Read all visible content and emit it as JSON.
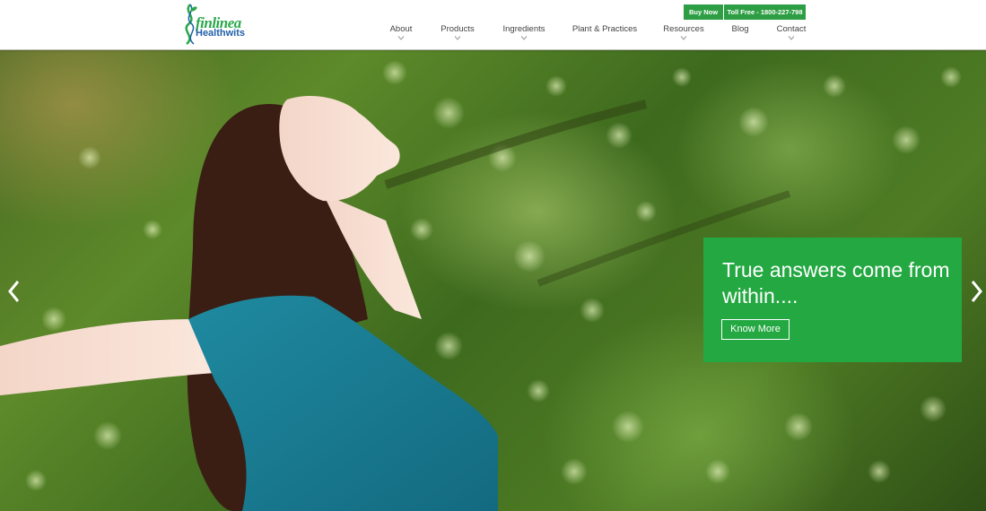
{
  "brand": {
    "name_top": "finlinea",
    "name_bottom": "Healthwits",
    "primary_color": "#2aa84a",
    "secondary_color": "#1f5fa8"
  },
  "topbar": {
    "buy_now": "Buy Now",
    "toll_free": "Toll Free - 1800-227-798"
  },
  "nav": {
    "items": [
      {
        "label": "About",
        "has_dropdown": true
      },
      {
        "label": "Products",
        "has_dropdown": true
      },
      {
        "label": "Ingredients",
        "has_dropdown": true
      },
      {
        "label": "Plant & Practices",
        "has_dropdown": false
      },
      {
        "label": "Resources",
        "has_dropdown": true
      },
      {
        "label": "Blog",
        "has_dropdown": false
      },
      {
        "label": "Contact",
        "has_dropdown": true
      }
    ]
  },
  "hero": {
    "slide_title": "True answers come from within....",
    "cta_label": "Know More",
    "callout_color": "#24a842",
    "prev_icon": "chevron-left-icon",
    "next_icon": "chevron-right-icon"
  }
}
